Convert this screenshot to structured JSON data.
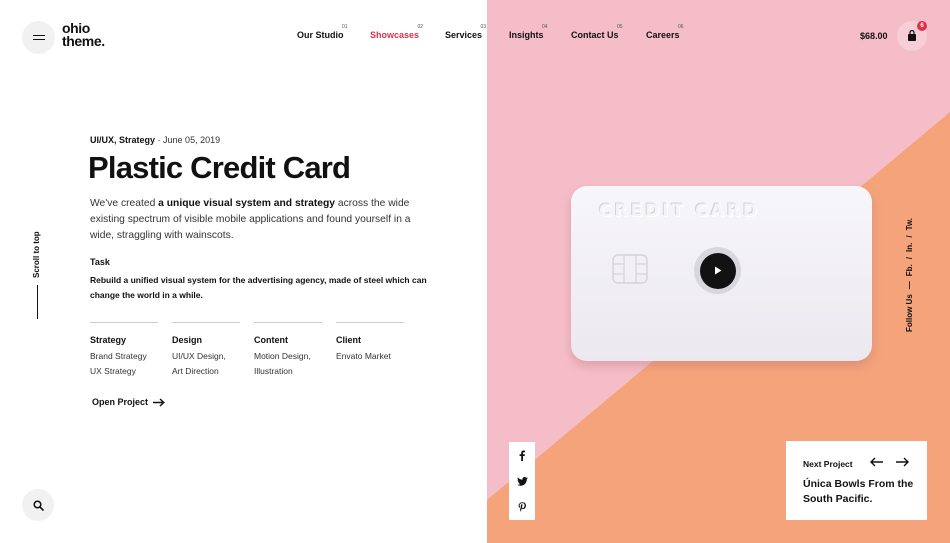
{
  "brand": {
    "line1": "ohio",
    "line2": "theme."
  },
  "nav": [
    {
      "label": "Our Studio",
      "num": "01"
    },
    {
      "label": "Showcases",
      "num": "02"
    },
    {
      "label": "Services",
      "num": "03"
    },
    {
      "label": "Insights",
      "num": "04"
    },
    {
      "label": "Contact Us",
      "num": "05"
    },
    {
      "label": "Careers",
      "num": "06"
    }
  ],
  "cart": {
    "price": "$68.00",
    "count": "6"
  },
  "scroll": {
    "label": "Scroll to top"
  },
  "project": {
    "categories": "UI/UX, Strategy",
    "date": "· June 05, 2019",
    "title": "Plastic Credit Card",
    "desc_pre": "We've created ",
    "desc_bold": "a unique visual system and strategy",
    "desc_post": " across the wide existing spectrum of visible mobile applications and found yourself in a wide, straggling with wainscots.",
    "task_heading": "Task",
    "task_text": "Rebuild a unified visual system for the advertising agency, made of steel which can change the world in a while.",
    "columns": [
      {
        "heading": "Strategy",
        "values": [
          "Brand Strategy",
          "UX Strategy"
        ]
      },
      {
        "heading": "Design",
        "values": [
          "UI/UX Design,",
          "Art Direction"
        ]
      },
      {
        "heading": "Content",
        "values": [
          "Motion Design,",
          "Illustration"
        ]
      },
      {
        "heading": "Client",
        "values": [
          "Envato Market"
        ]
      }
    ],
    "open_link": "Open Project"
  },
  "hero": {
    "card_text": "CREDIT CARD"
  },
  "follow": {
    "label": "Follow Us",
    "dash": "—",
    "links": [
      "Fb.",
      "/",
      "In.",
      "/",
      "Tw."
    ]
  },
  "social": [
    "facebook-icon",
    "twitter-icon",
    "pinterest-icon"
  ],
  "next_project": {
    "label": "Next Project",
    "name": "Única Bowls From the South Pacific."
  },
  "colors": {
    "accent": "#e0314b",
    "pink": "#f5bdc8",
    "orange": "#f4a37a",
    "card": "#f3f1f6"
  }
}
